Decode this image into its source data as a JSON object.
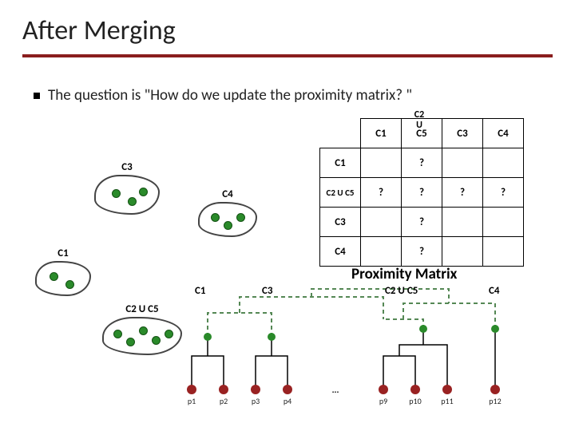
{
  "title": "After Merging",
  "bullet": "The question is \"How do we update the proximity matrix? \"",
  "clusters": {
    "c1": "C1",
    "c25": "C2 U C5",
    "c3": "C3",
    "c4": "C4"
  },
  "matrix": {
    "col_head_super": "C2\nU",
    "cols": [
      "C1",
      "C5",
      "C3",
      "C4"
    ],
    "rows": [
      "C1",
      "C2 U C5",
      "C3",
      "C4"
    ],
    "cells": [
      [
        "",
        "?",
        "",
        ""
      ],
      [
        "?",
        "?",
        "?",
        "?"
      ],
      [
        "",
        "?",
        "",
        ""
      ],
      [
        "",
        "?",
        "",
        ""
      ]
    ],
    "caption": "Proximity Matrix"
  },
  "dendro": {
    "top_labels": [
      "C1",
      "C3",
      "C2 U C5",
      "C4"
    ],
    "leaves": [
      "p1",
      "p2",
      "p3",
      "p4",
      "p9",
      "p10",
      "p11",
      "p12"
    ],
    "ellipsis": "..."
  }
}
